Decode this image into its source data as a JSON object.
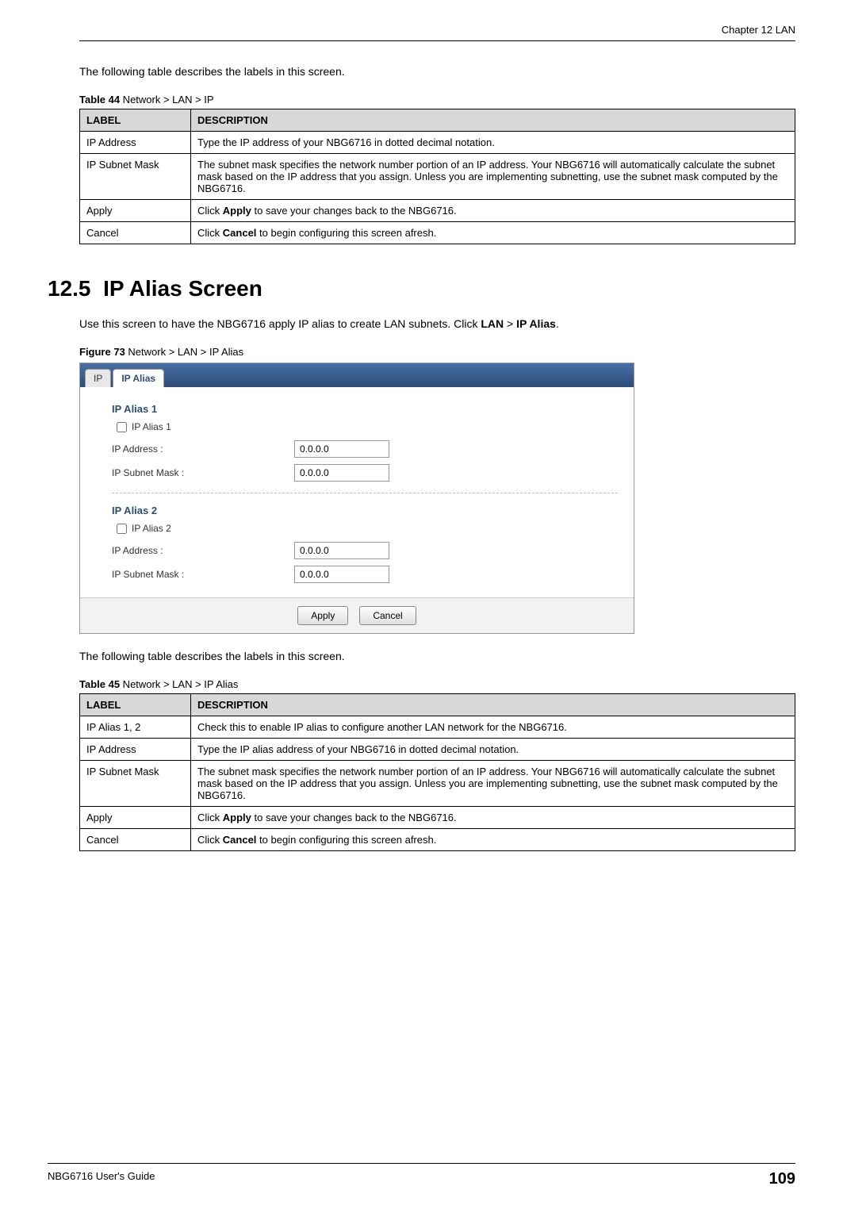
{
  "header": {
    "chapter": "Chapter 12 LAN"
  },
  "intro1": "The following table describes the labels in this screen.",
  "table44": {
    "caption_num": "Table 44",
    "caption_text": "   Network > LAN > IP",
    "headers": {
      "label": "LABEL",
      "desc": "DESCRIPTION"
    },
    "rows": [
      {
        "label": "IP Address",
        "desc": "Type the IP address of your NBG6716 in dotted decimal notation."
      },
      {
        "label": "IP Subnet Mask",
        "desc": "The subnet mask specifies the network number portion of an IP address. Your NBG6716 will automatically calculate the subnet mask based on the IP address that you assign. Unless you are implementing subnetting, use the subnet mask computed by the NBG6716."
      },
      {
        "label": "Apply",
        "desc_pre": "Click ",
        "desc_bold": "Apply",
        "desc_post": " to save your changes back to the NBG6716."
      },
      {
        "label": "Cancel",
        "desc_pre": "Click ",
        "desc_bold": "Cancel",
        "desc_post": " to begin configuring this screen afresh."
      }
    ]
  },
  "section": {
    "num": "12.5",
    "title": "IP Alias Screen"
  },
  "para1_pre": "Use this screen to have the NBG6716 apply IP alias to create LAN subnets. Click ",
  "para1_b1": "LAN",
  "para1_mid": " > ",
  "para1_b2": "IP Alias",
  "para1_post": ".",
  "figure73": {
    "caption_num": "Figure 73",
    "caption_text": "   Network > LAN > IP Alias",
    "tabs": {
      "ip": "IP",
      "ipalias": "IP Alias"
    },
    "alias1": {
      "title": "IP Alias 1",
      "checkbox_label": "IP Alias 1",
      "ip_label": "IP Address :",
      "ip_value": "0.0.0.0",
      "mask_label": "IP Subnet Mask :",
      "mask_value": "0.0.0.0"
    },
    "alias2": {
      "title": "IP Alias 2",
      "checkbox_label": "IP Alias 2",
      "ip_label": "IP Address :",
      "ip_value": "0.0.0.0",
      "mask_label": "IP Subnet Mask :",
      "mask_value": "0.0.0.0"
    },
    "buttons": {
      "apply": "Apply",
      "cancel": "Cancel"
    }
  },
  "intro2": "The following table describes the labels in this screen.",
  "table45": {
    "caption_num": "Table 45",
    "caption_text": "   Network > LAN > IP Alias",
    "headers": {
      "label": "LABEL",
      "desc": "DESCRIPTION"
    },
    "rows": [
      {
        "label": "IP Alias 1, 2",
        "desc": "Check this to enable IP alias to configure another LAN network for the NBG6716."
      },
      {
        "label": "IP Address",
        "desc": "Type the IP alias address of your NBG6716 in dotted decimal notation."
      },
      {
        "label": "IP Subnet Mask",
        "desc": "The subnet mask specifies the network number portion of an IP address. Your NBG6716 will automatically calculate the subnet mask based on the IP address that you assign. Unless you are implementing subnetting, use the subnet mask computed by the NBG6716."
      },
      {
        "label": "Apply",
        "desc_pre": "Click ",
        "desc_bold": "Apply",
        "desc_post": " to save your changes back to the NBG6716."
      },
      {
        "label": "Cancel",
        "desc_pre": "Click ",
        "desc_bold": "Cancel",
        "desc_post": " to begin configuring this screen afresh."
      }
    ]
  },
  "footer": {
    "guide": "NBG6716 User's Guide",
    "page": "109"
  }
}
